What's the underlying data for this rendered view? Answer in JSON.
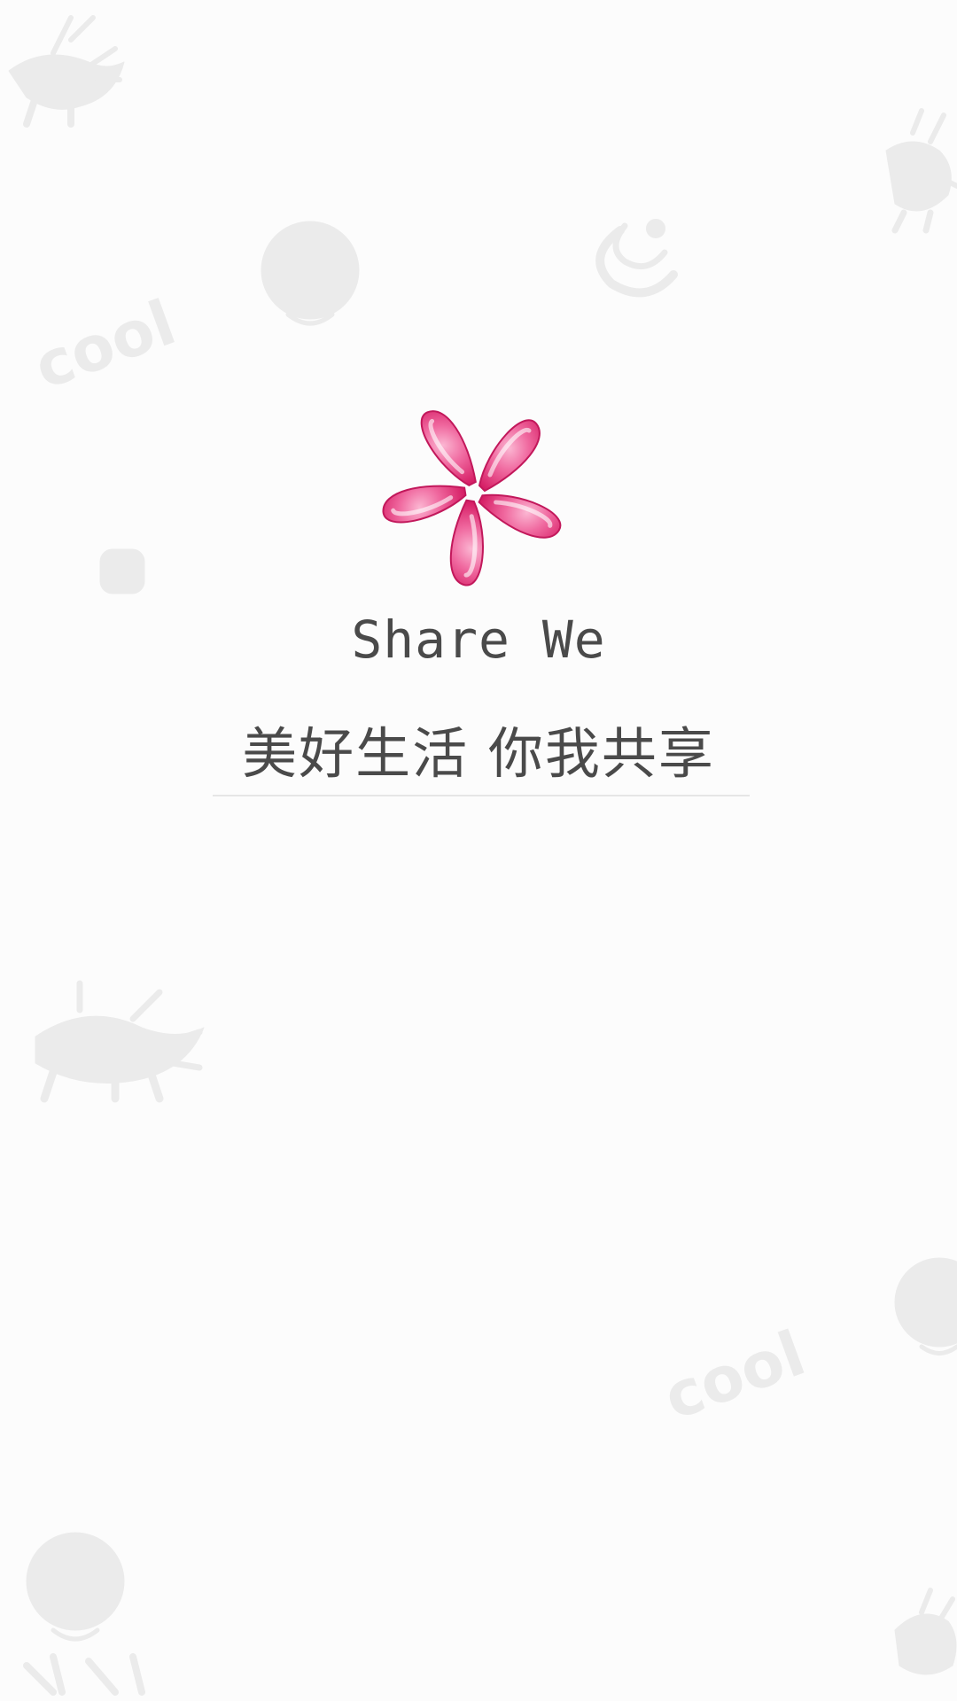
{
  "splash": {
    "app_name": "Share We",
    "slogan": "美好生活 你我共享"
  },
  "background": {
    "doodle_words": [
      "cool",
      "cool"
    ]
  },
  "colors": {
    "background": "#fcfcfc",
    "text": "#4a4a4a",
    "logo_pink": "#e8327a",
    "doodle": "#e6e6e6"
  },
  "icons": [
    "flower-logo-icon",
    "reindeer-doodle-icon",
    "face-doodle-icon",
    "cool-doodle-icon",
    "spiral-doodle-icon",
    "python-doodle-icon"
  ]
}
